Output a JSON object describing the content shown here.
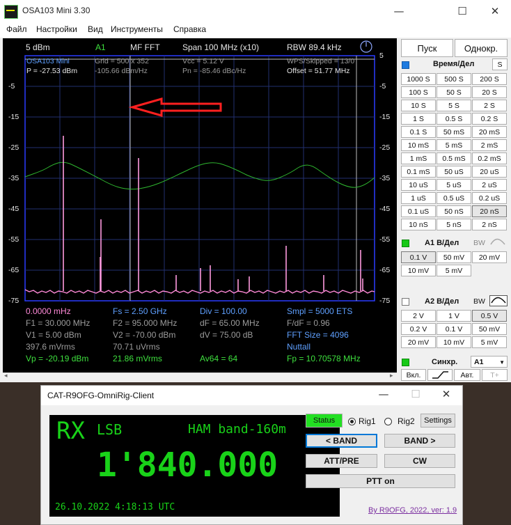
{
  "osa": {
    "title": "OSA103 Mini 3.30",
    "win_min": "—",
    "win_max": "☐",
    "win_close": "✕",
    "menu": [
      "Файл",
      "Настройки",
      "Вид",
      "Инструменты",
      "Справка"
    ],
    "scope": {
      "top_left_level": "5 dBm",
      "channel": "A1",
      "mode": "MF FFT",
      "span": "Span 100 MHz (x10)",
      "rbw": "RBW 89.4 kHz",
      "info": {
        "model": "OSA103 Mini",
        "grid": "Grid = 500 x 352",
        "vcc": "Vcc = 5.12 V",
        "wps": "WPS/Skipped  =  13/0",
        "power": "P = -27.53 dBm",
        "density": "-105.66 dBm/Hz",
        "pn": "Pn = -85.46 dBc/Hz",
        "offset": "Offset = 51.77 MHz"
      },
      "y_labels_left": [
        "-5",
        "-15",
        "-25",
        "-35",
        "-45",
        "-55",
        "-65",
        "-75"
      ],
      "y_labels_right": [
        "5",
        "-5",
        "-15",
        "-25",
        "-35",
        "-45",
        "-55",
        "-65",
        "-75"
      ],
      "readout": {
        "start": "0.0000 mHz",
        "fs": "Fs = 2.50 GHz",
        "div": "Div = 100.00",
        "smpl": "Smpl = 5000 ETS",
        "f1": "F1 = 30.000 MHz",
        "f2": "F2 = 95.000 MHz",
        "df": "dF = 65.00 MHz",
        "fdf": "F/dF = 0.96",
        "v1": "V1 = 5.00 dBm",
        "v2": "V2 = -70.00 dBm",
        "dv": "dV = 75.00 dB",
        "fft": "FFT Size = 4096",
        "mvrms1": "397.6 mVrms",
        "uvrms": "70.71 uVrms",
        "window": "Nuttall",
        "vp": "Vp = -20.19 dBm",
        "mvrms2": "21.86 mVrms",
        "av": "Av64 = 64",
        "fp": "Fp = 10.70578 MHz"
      }
    },
    "panel": {
      "run": "Пуск",
      "single": "Однокр.",
      "time_label": "Время/Дел",
      "s_btn": "S",
      "time_buttons": [
        [
          "1000 S",
          "500 S",
          "200 S"
        ],
        [
          "100 S",
          "50 S",
          "20 S"
        ],
        [
          "10 S",
          "5 S",
          "2 S"
        ],
        [
          "1 S",
          "0.5 S",
          "0.2 S"
        ],
        [
          "0.1 S",
          "50 mS",
          "20 mS"
        ],
        [
          "10 mS",
          "5 mS",
          "2 mS"
        ],
        [
          "1 mS",
          "0.5 mS",
          "0.2 mS"
        ],
        [
          "0.1 mS",
          "50 uS",
          "20 uS"
        ],
        [
          "10 uS",
          "5 uS",
          "2 uS"
        ],
        [
          "1 uS",
          "0.5 uS",
          "0.2 uS"
        ],
        [
          "0.1 uS",
          "50 nS",
          "20 nS"
        ],
        [
          "10 nS",
          "5 nS",
          "2 nS"
        ]
      ],
      "a1_label": "A1 В/Дел",
      "a1_bw": "BW",
      "a1_buttons": [
        [
          "0.1 V",
          "50 mV",
          "20 mV"
        ],
        [
          "10 mV",
          "5 mV",
          ""
        ]
      ],
      "a2_label": "A2 В/Дел",
      "a2_bw": "BW",
      "a2_buttons": [
        [
          "2 V",
          "1 V",
          "0.5 V"
        ],
        [
          "0.2 V",
          "0.1 V",
          "50 mV"
        ],
        [
          "20 mV",
          "10 mV",
          "5 mV"
        ]
      ],
      "sync_label": "Синхр.",
      "sync_value": "A1",
      "on_btn": "Вкл.",
      "auto_btn": "Авт.",
      "t_btn": "T+"
    }
  },
  "cat": {
    "title": "CAT-R9OFG-OmniRig-Client",
    "win_min": "—",
    "win_max": "☐",
    "win_close": "✕",
    "lcd": {
      "rx": "RX",
      "mode": "LSB",
      "band": "HAM band-160m",
      "freq": "1'840.000",
      "datetime": "26.10.2022 4:18:13 UTC"
    },
    "status": "Status",
    "rig1": "Rig1",
    "rig2": "Rig2",
    "settings": "Settings",
    "band_down": "< BAND",
    "band_up": "BAND >",
    "att": "ATT/PRE",
    "cw": "CW",
    "ptt": "PTT on",
    "credit": "By R9OFG, 2022, ver: 1.9",
    "colors": {
      "status_bg": "#22e022",
      "lcd_text": "#19d219"
    }
  }
}
